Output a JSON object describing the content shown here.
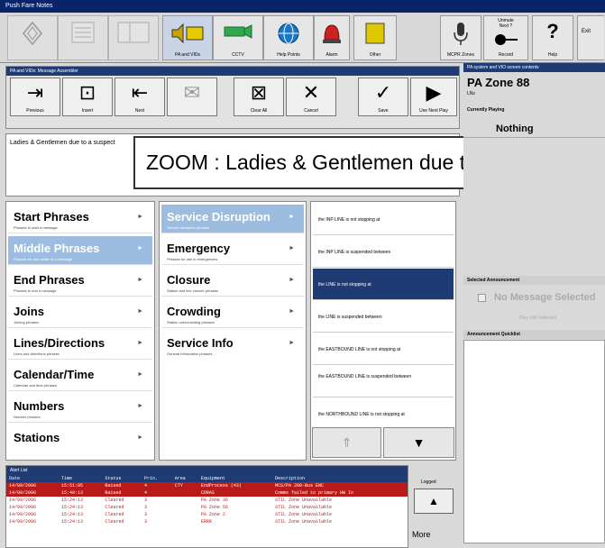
{
  "window": {
    "title": "Push Fare Notes"
  },
  "toolbar": [
    {
      "label": "",
      "icon": "diamond-icon",
      "state": "disabled"
    },
    {
      "label": "",
      "icon": "list-icon",
      "state": "disabled"
    },
    {
      "label": "",
      "icon": "layout-icon",
      "state": "disabled"
    },
    {
      "label": "PA and VIDs",
      "icon": "pa-vids-icon",
      "state": "active"
    },
    {
      "label": "CCTV",
      "icon": "camera-icon",
      "state": "normal"
    },
    {
      "label": "Help Points",
      "icon": "globe-icon",
      "state": "normal"
    },
    {
      "label": "Alarm",
      "icon": "alarm-icon",
      "state": "normal"
    },
    {
      "label": "Other",
      "icon": "note-icon",
      "state": "normal"
    },
    {
      "label": "MCPR Zones",
      "icon": "microphone-icon",
      "state": "normal"
    },
    {
      "label": "Record",
      "icon": "record-icon",
      "state": "normal",
      "caption": "Unmute\nNext ?"
    },
    {
      "label": "Help",
      "icon": "help-icon",
      "state": "normal",
      "glyph": "?"
    },
    {
      "label": "Exit",
      "icon": "exit-icon",
      "state": "normal",
      "caption": "Exit"
    }
  ],
  "editor": {
    "header": "PA and VIDs: Message Assembler",
    "buttons": [
      {
        "label": "Previous",
        "icon": "previous-icon",
        "glyph": "⇥"
      },
      {
        "label": "Insert",
        "icon": "insert-icon",
        "glyph": "⊡"
      },
      {
        "label": "Next",
        "icon": "next-icon",
        "glyph": "⇤"
      },
      {
        "label": "",
        "icon": "mail-icon",
        "glyph": "✉"
      },
      {
        "label": "Clear All",
        "icon": "clear-all-icon",
        "glyph": "⊠"
      },
      {
        "label": "Cancel",
        "icon": "cancel-icon",
        "glyph": "✕"
      },
      {
        "label": "Save",
        "icon": "save-icon",
        "glyph": "✓"
      },
      {
        "label": "Use Next Play",
        "icon": "play-icon",
        "glyph": "▶"
      }
    ],
    "message": "Ladies & Gentlemen due to a suspect",
    "zoom": "ZOOM : Ladies & Gentlemen due to a suspect"
  },
  "categories": [
    {
      "title": "Start Phrases",
      "sub": "Phrases to start a message",
      "arrow": "►"
    },
    {
      "title": "Middle Phrases",
      "sub": "Phrases for the middle of a message",
      "arrow": "►",
      "selected": true
    },
    {
      "title": "End Phrases",
      "sub": "Phrases to end a message",
      "arrow": "►"
    },
    {
      "title": "Joins",
      "sub": "Joining phrases",
      "arrow": "►"
    },
    {
      "title": "Lines/Directions",
      "sub": "Lines and directions phrases",
      "arrow": "►"
    },
    {
      "title": "Calendar/Time",
      "sub": "Calendar and time phrases",
      "arrow": "►"
    },
    {
      "title": "Numbers",
      "sub": "Number phrases",
      "arrow": "►"
    },
    {
      "title": "Stations",
      "sub": "",
      "arrow": "►"
    }
  ],
  "subcategories": [
    {
      "title": "Service Disruption",
      "sub": "Service disruption phrases",
      "arrow": "►",
      "selected": true
    },
    {
      "title": "Emergency",
      "sub": "Phrases for use in emergencies",
      "arrow": "►"
    },
    {
      "title": "Closure",
      "sub": "Station and line closure phrases",
      "arrow": "►"
    },
    {
      "title": "Crowding",
      "sub": "Station overcrowding phrases",
      "arrow": "►"
    },
    {
      "title": "Service Info",
      "sub": "General information phrases",
      "arrow": "►"
    }
  ],
  "phrases": [
    {
      "text": "the INP LINE is not stopping at"
    },
    {
      "text": "the INP LINE is suspended between"
    },
    {
      "text": "the LINE is not stopping at",
      "selected": true
    },
    {
      "text": "the LINE is suspended between"
    },
    {
      "text": "the EASTBOUND LINE is not stopping at"
    },
    {
      "text": "the EASTBOUND LINE is suspended between"
    },
    {
      "text": "the NORTHBOUND LINE is not stopping at"
    }
  ],
  "phrase_scroll": {
    "up": "⇑",
    "down": "▼"
  },
  "right_panel": {
    "header": "PA system and VIO screen contents",
    "zone_title": "PA Zone 88",
    "zone_sub": "LNs",
    "currently_playing_label": "Currently Playing",
    "currently_playing": "Nothing",
    "selected_header": "Selected Announcement",
    "selected_value": "No Message Selected",
    "selected_action": "Play with Selected",
    "quicklist_header": "Announcement Quicklist"
  },
  "alerts": {
    "header": "Alert List",
    "columns": [
      "Date",
      "Time",
      "Status",
      "Prio.",
      "Area",
      "Equipment",
      "Description"
    ],
    "rows": [
      {
        "date": "14/09/2006",
        "time": "15:51:05",
        "status": "Raised",
        "prio": "4",
        "area": "CTY",
        "equip": "EndProcess (43)",
        "desc": "MCS/PA 200-Bus ENC",
        "style": "r1"
      },
      {
        "date": "14/09/2006",
        "time": "15:49:13",
        "status": "Raised",
        "prio": "4",
        "area": "",
        "equip": "CDRAS",
        "desc": "Comms failed to primary HW In",
        "style": "r2"
      },
      {
        "date": "14/09/2006",
        "time": "15:24:13",
        "status": "Cleared",
        "prio": "3",
        "area": "",
        "equip": "PA Zone 36",
        "desc": "STIL Zone Unavailable",
        "style": "r3"
      },
      {
        "date": "14/09/2006",
        "time": "15:24:13",
        "status": "Cleared",
        "prio": "3",
        "area": "",
        "equip": "PA Zone 56",
        "desc": "STIL Zone Unavailable",
        "style": "r3"
      },
      {
        "date": "14/09/2006",
        "time": "15:24:13",
        "status": "Cleared",
        "prio": "3",
        "area": "",
        "equip": "PA Zone 2",
        "desc": "STIL Zone Unavailable",
        "style": "r3"
      },
      {
        "date": "14/09/2006",
        "time": "15:24:13",
        "status": "Cleared",
        "prio": "3",
        "area": "",
        "equip": "ERRR",
        "desc": "STIL Zone Unavailable",
        "style": "r3"
      }
    ],
    "side_label": "Logged",
    "scroll_up": "▲",
    "more_label": "More"
  }
}
